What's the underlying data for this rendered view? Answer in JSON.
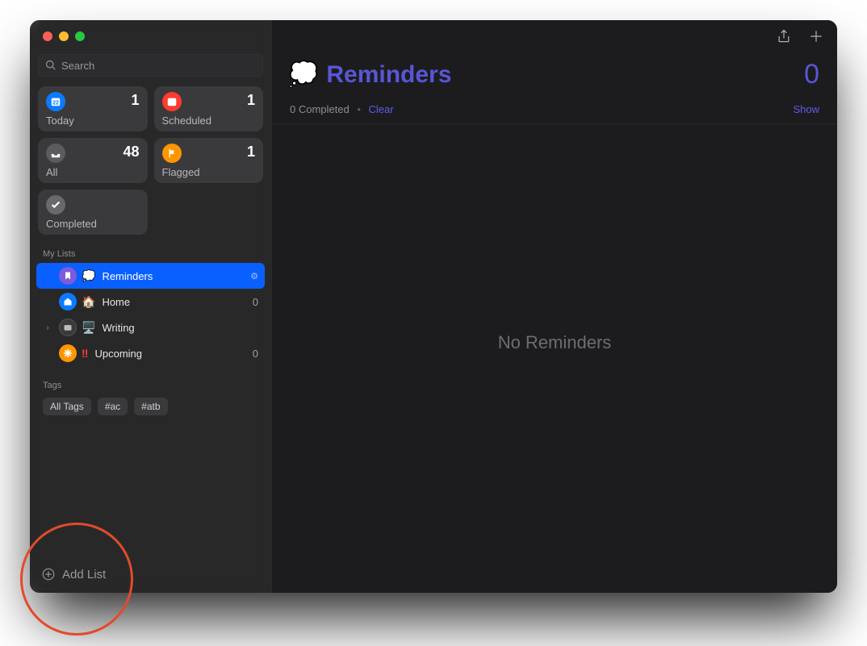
{
  "search": {
    "placeholder": "Search"
  },
  "cards": {
    "today": {
      "label": "Today",
      "count": "1"
    },
    "scheduled": {
      "label": "Scheduled",
      "count": "1"
    },
    "all": {
      "label": "All",
      "count": "48"
    },
    "flagged": {
      "label": "Flagged",
      "count": "1"
    },
    "completed": {
      "label": "Completed",
      "count": ""
    }
  },
  "sidebar": {
    "myLists_header": "My Lists",
    "lists": {
      "reminders": {
        "name": "Reminders",
        "count": ""
      },
      "home": {
        "name": "Home",
        "count": "0"
      },
      "writing": {
        "name": "Writing",
        "count": ""
      },
      "upcoming": {
        "name": "Upcoming",
        "count": "0"
      }
    },
    "tags_header": "Tags",
    "tags": {
      "all": "All Tags",
      "t1": "#ac",
      "t2": "#atb"
    },
    "add_list": "Add List"
  },
  "main": {
    "title_emoji": "💭",
    "title": "Reminders",
    "count": "0",
    "completed_text": "0 Completed",
    "clear_label": "Clear",
    "show_label": "Show",
    "empty_text": "No Reminders"
  }
}
